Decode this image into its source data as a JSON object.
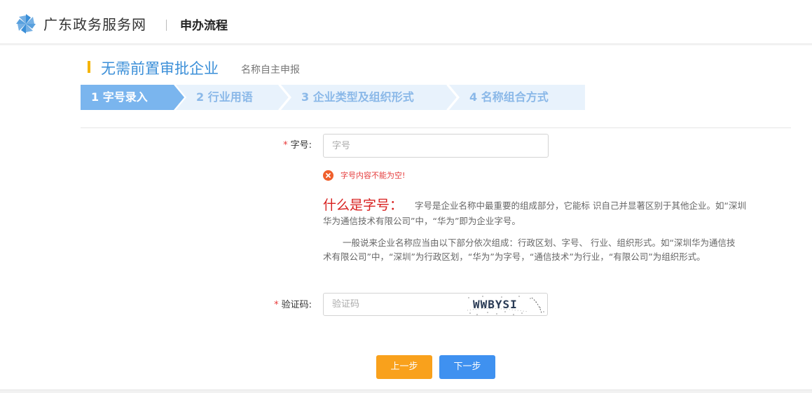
{
  "header": {
    "site_title": "广东政务服务网",
    "page_name": "申办流程",
    "logo_icon": "pinwheel-logo-icon",
    "logo_color": "#3b8fd8"
  },
  "page": {
    "main_title": "无需前置审批企业",
    "sub_title": "名称自主申报"
  },
  "steps": [
    {
      "label": "1 字号录入",
      "active": true
    },
    {
      "label": "2 行业用语",
      "active": false
    },
    {
      "label": "3 企业类型及组织形式",
      "active": false
    },
    {
      "label": "4 名称组合方式",
      "active": false
    }
  ],
  "form": {
    "zihao": {
      "label": "字号:",
      "placeholder": "字号",
      "value": "",
      "error": "字号内容不能为空!"
    },
    "captcha": {
      "label": "验证码:",
      "placeholder": "验证码",
      "value": "",
      "image_text": "WWBYSI"
    }
  },
  "help": {
    "title": "什么是字号：",
    "p1_line1": "字号是企业名称中最重要的组成部分，它能标 识自己并显著区别于其他企业。如“深圳",
    "p1_line2": "华为通信技术有限公司”中，“华为”即为企业字号。",
    "p2_line1": "一般说来企业名称应当由以下部分依次组成：行政区划、字号、 行业、组织形式。如“深圳华为通信技",
    "p2_line2": "术有限公司”中，“深圳”为行政区划，“华为”为字号，“通信技术”为行业，“有限公司”为组织形式。"
  },
  "buttons": {
    "prev": "上一步",
    "next": "下一步"
  },
  "colors": {
    "accent": "#3b8fd8",
    "step_active": "#7ab5ee",
    "step_inactive": "#e8f2fc",
    "error": "#e53c3c",
    "prev_button": "#f9a11c",
    "next_button": "#3f91f0"
  }
}
